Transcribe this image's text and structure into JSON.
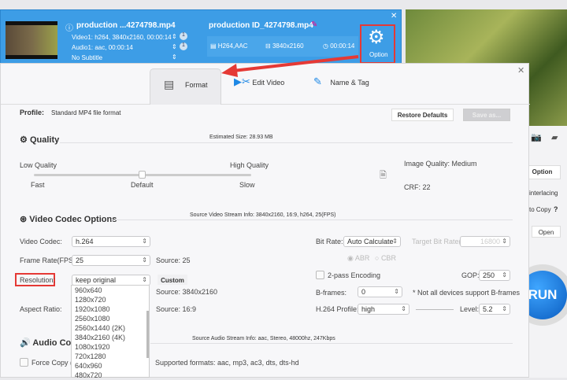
{
  "file": {
    "source_name": "production ...4274798.mp4",
    "video_track": "Video1: h264, 3840x2160, 00:00:14",
    "audio_track": "Audio1: aac, 00:00:14",
    "subtitle": "No Subtitle",
    "video_count": "1",
    "audio_count": "1",
    "output_name": "production ID_4274798.mp4",
    "format": "H264,AAC",
    "resolution": "3840x2160",
    "duration": "00:00:14",
    "option_label": "Option",
    "codec_badge": "codec"
  },
  "tabs": [
    {
      "label": "Format",
      "active": true
    },
    {
      "label": "Edit Video"
    },
    {
      "label": "Name & Tag"
    }
  ],
  "profile": {
    "label": "Profile:",
    "value": "Standard MP4 file format",
    "restore": "Restore Defaults",
    "save_as": "Save as..."
  },
  "quality": {
    "heading": "Quality",
    "estimated_size": "Estimated Size: 28.93 MB",
    "low": "Low Quality",
    "high": "High Quality",
    "fast": "Fast",
    "default": "Default",
    "slow": "Slow",
    "level": 0.5,
    "image_quality": "Image Quality: Medium",
    "crf": "CRF: 22"
  },
  "video": {
    "heading": "Video Codec Options",
    "source_info": "Source Video Stream Info: 3840x2160, 16:9, h264, 25(FPS)",
    "codec_label": "Video Codec:",
    "codec": "h.264",
    "fps_label": "Frame Rate(FPS):",
    "fps": "25",
    "fps_source": "Source: 25",
    "res_label": "Resolution:",
    "res": "keep original",
    "custom": "Custom",
    "res_source": "Source: 3840x2160",
    "aspect_label": "Aspect Ratio:",
    "aspect_source": "Source: 16:9",
    "res_options": [
      "960x640",
      "1280x720",
      "1920x1080",
      "2560x1080",
      "2560x1440 (2K)",
      "3840x2160 (4K)",
      "1080x1920",
      "720x1280",
      "640x960",
      "480x720"
    ],
    "bitrate_label": "Bit Rate:",
    "bitrate": "Auto Calculate",
    "target_label": "Target Bit Rate(kbps):",
    "target": "16800",
    "abr": "ABR",
    "cbr": "CBR",
    "twopass": "2-pass Encoding",
    "gop_label": "GOP:",
    "gop": "250",
    "bframes_label": "B-frames:",
    "bframes": "0",
    "bframes_note": "* Not all devices support B-frames",
    "profile_label": "H.264 Profile:",
    "profile": "high",
    "level_label": "Level:",
    "level": "5.2"
  },
  "audio": {
    "heading": "Audio Codec Options",
    "source_info": "Source Audio Stream Info: aac, Stereo, 48000hz, 247Kbps",
    "force_copy": "Force Copy (Passthrough)",
    "supported": "Supported formats: aac, mp3, ac3, dts, dts-hd"
  },
  "side": {
    "option": "Option",
    "interlacing": "interlacing",
    "copy": "to Copy",
    "help": "?",
    "open": "Open",
    "run": "RUN"
  },
  "colors": {
    "accent": "#3d9de6",
    "highlight": "#e53935"
  }
}
